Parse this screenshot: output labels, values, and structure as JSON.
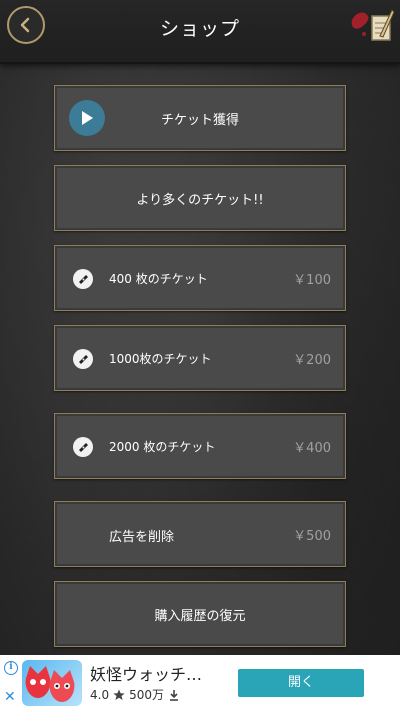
{
  "header": {
    "title": "ショップ",
    "back_icon": "back-arrow-icon",
    "notes_icon": "notepad-pencil-icon"
  },
  "shop": {
    "get_ticket": {
      "label": "チケット獲得",
      "icon": "play-icon"
    },
    "more_tickets": {
      "label": "より多くのチケット!!"
    },
    "items": [
      {
        "label": "400  枚のチケット",
        "price": "￥100",
        "icon": "ticket-icon"
      },
      {
        "label": "1000枚のチケット",
        "price": "￥200",
        "icon": "ticket-icon"
      },
      {
        "label": "2000  枚のチケット",
        "price": "￥400",
        "icon": "ticket-icon"
      }
    ],
    "remove_ads": {
      "label": "広告を削除",
      "price": "￥500"
    },
    "restore": {
      "label": "購入履歴の復元"
    }
  },
  "ad": {
    "app_name": "妖怪ウォッチ…",
    "rating": "4.0",
    "downloads": "500万",
    "open_label": "開く",
    "info_icon": "info-icon",
    "close_icon": "close-icon"
  },
  "colors": {
    "accent_border": "#8e7d58",
    "button_bg": "#4a4a4a",
    "play_bg": "#3d7c97",
    "ad_button": "#2aa5b8"
  }
}
